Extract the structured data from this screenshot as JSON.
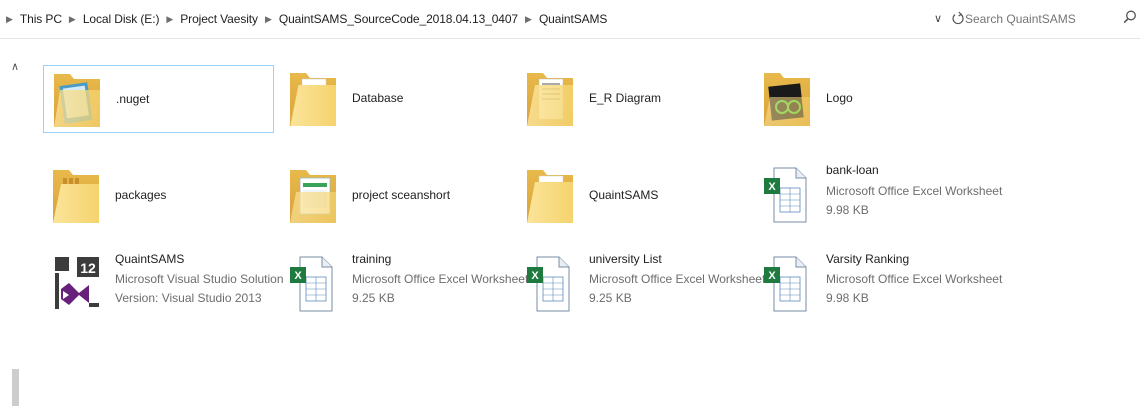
{
  "breadcrumb": [
    "This PC",
    "Local Disk (E:)",
    "Project Vaesity",
    "QuaintSAMS_SourceCode_2018.04.13_0407",
    "QuaintSAMS"
  ],
  "search": {
    "placeholder": "Search QuaintSAMS"
  },
  "colors": {
    "selection_border": "#99d1ff",
    "secondary_text": "#6d6d6d",
    "folder": "#f7d673",
    "excel_green": "#1f7a3f",
    "vs_purple": "#68217a"
  },
  "items": [
    {
      "name": ".nuget",
      "icon": "folder-nuget-icon"
    },
    {
      "name": "Database",
      "icon": "folder-icon"
    },
    {
      "name": "E_R Diagram",
      "icon": "folder-docs-icon"
    },
    {
      "name": "Logo",
      "icon": "folder-image-icon"
    },
    {
      "name": "packages",
      "icon": "folder-icon"
    },
    {
      "name": "project sceanshort",
      "icon": "folder-image-icon"
    },
    {
      "name": "QuaintSAMS",
      "icon": "folder-icon"
    },
    {
      "name": "bank-loan",
      "type": "Microsoft Office Excel Worksheet",
      "size": "9.98 KB",
      "icon": "excel-file-icon"
    },
    {
      "name": "QuaintSAMS",
      "type": "Microsoft Visual Studio Solution",
      "size": "Version: Visual Studio 2013",
      "icon": "vs-solution-icon"
    },
    {
      "name": "training",
      "type": "Microsoft Office Excel Worksheet",
      "size": "9.25 KB",
      "icon": "excel-file-icon"
    },
    {
      "name": "university List",
      "type": "Microsoft Office Excel Worksheet",
      "size": "9.25 KB",
      "icon": "excel-file-icon"
    },
    {
      "name": "Varsity Ranking",
      "type": "Microsoft Office Excel Worksheet",
      "size": "9.98 KB",
      "icon": "excel-file-icon"
    }
  ]
}
